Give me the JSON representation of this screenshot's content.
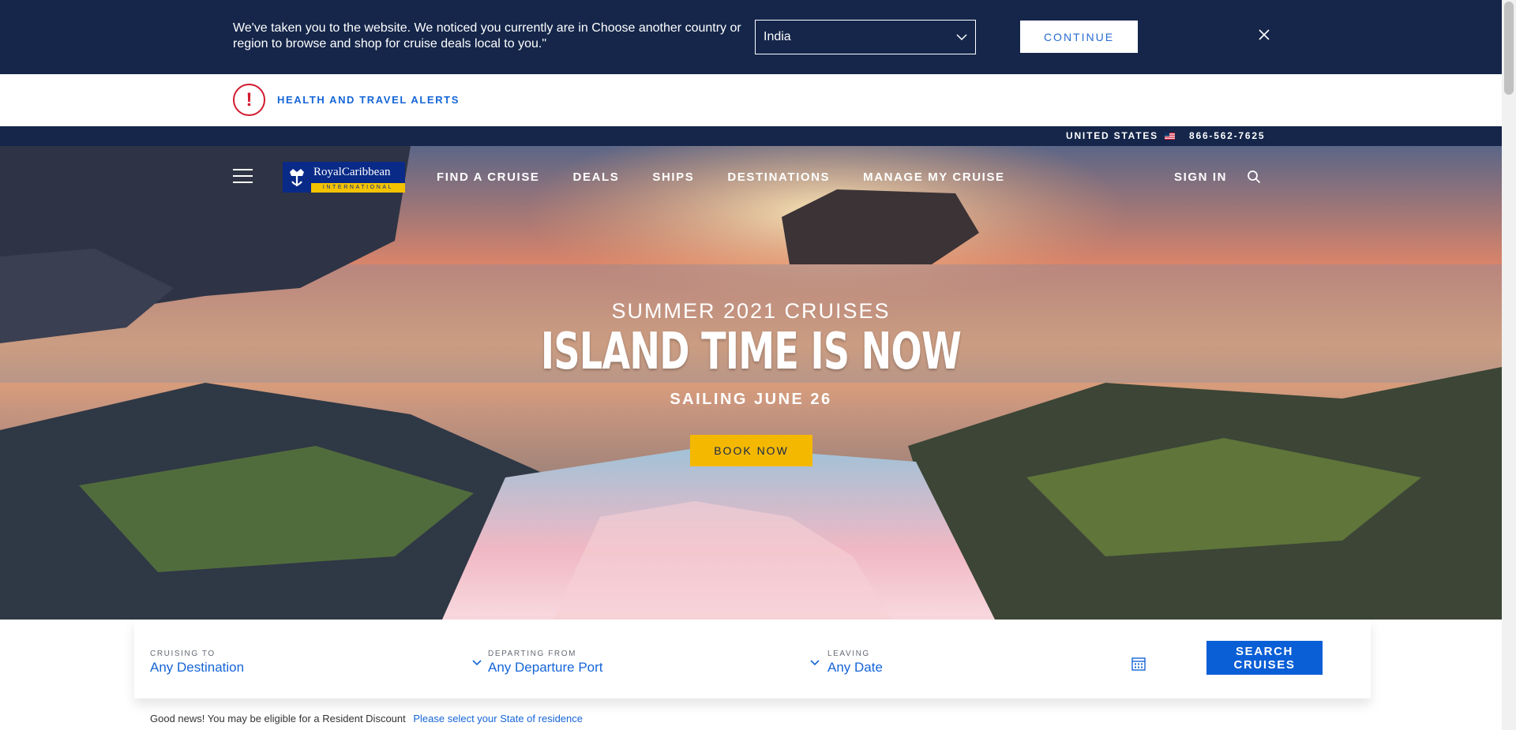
{
  "country_banner": {
    "message": "We've taken you to the website. We noticed you currently are in Choose another country or region to browse and shop for cruise deals local to you.\"",
    "selected_country": "India",
    "continue_label": "CONTINUE"
  },
  "alerts": {
    "label": "HEALTH AND TRAVEL ALERTS",
    "icon_glyph": "!"
  },
  "utility": {
    "country": "UNITED STATES",
    "phone": "866-562-7625"
  },
  "logo": {
    "name": "RoyalCaribbean",
    "tagline": "INTERNATIONAL"
  },
  "nav": {
    "items": [
      "FIND A CRUISE",
      "DEALS",
      "SHIPS",
      "DESTINATIONS",
      "MANAGE MY CRUISE"
    ],
    "sign_in": "SIGN IN"
  },
  "hero": {
    "eyebrow": "SUMMER 2021 CRUISES",
    "title": "ISLAND TIME IS NOW",
    "subtitle": "SAILING JUNE 26",
    "cta": "BOOK NOW"
  },
  "search": {
    "cruising_to": {
      "label": "CRUISING TO",
      "value": "Any Destination"
    },
    "departing_from": {
      "label": "DEPARTING FROM",
      "value": "Any Departure Port"
    },
    "leaving": {
      "label": "LEAVING",
      "value": "Any Date"
    },
    "button": "SEARCH CRUISES"
  },
  "resident": {
    "text": "Good news! You may be eligible for a Resident Discount",
    "link": "Please select your State of residence"
  },
  "colors": {
    "navy": "#15264a",
    "accent_blue": "#1565d8",
    "cta_yellow": "#f4b800",
    "alert_red": "#d21a2e"
  }
}
